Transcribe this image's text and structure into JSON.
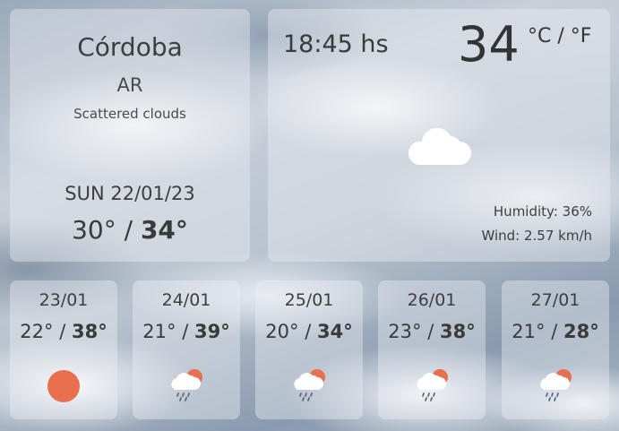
{
  "current": {
    "city": "Córdoba",
    "country": "AR",
    "description": "Scattered clouds",
    "date": "SUN 22/01/23",
    "min": "30°",
    "separator": " / ",
    "max": "34°",
    "time": "18:45 hs",
    "temp": "34",
    "units": "°C / °F",
    "icon": "cloud-icon",
    "humidity": "Humidity: 36%",
    "wind": "Wind: 2.57 km/h"
  },
  "forecast": [
    {
      "date": "23/01",
      "min": "22°",
      "max": "38°",
      "icon": "sun-icon"
    },
    {
      "date": "24/01",
      "min": "21°",
      "max": "39°",
      "icon": "rain-sun-icon"
    },
    {
      "date": "25/01",
      "min": "20°",
      "max": "34°",
      "icon": "rain-sun-icon"
    },
    {
      "date": "26/01",
      "min": "23°",
      "max": "38°",
      "icon": "rain-sun-icon"
    },
    {
      "date": "27/01",
      "min": "21°",
      "max": "28°",
      "icon": "rain-sun-icon"
    }
  ],
  "colors": {
    "sun": "#e9704f",
    "cloud": "#ffffff",
    "rain": "#5b6b7d"
  }
}
